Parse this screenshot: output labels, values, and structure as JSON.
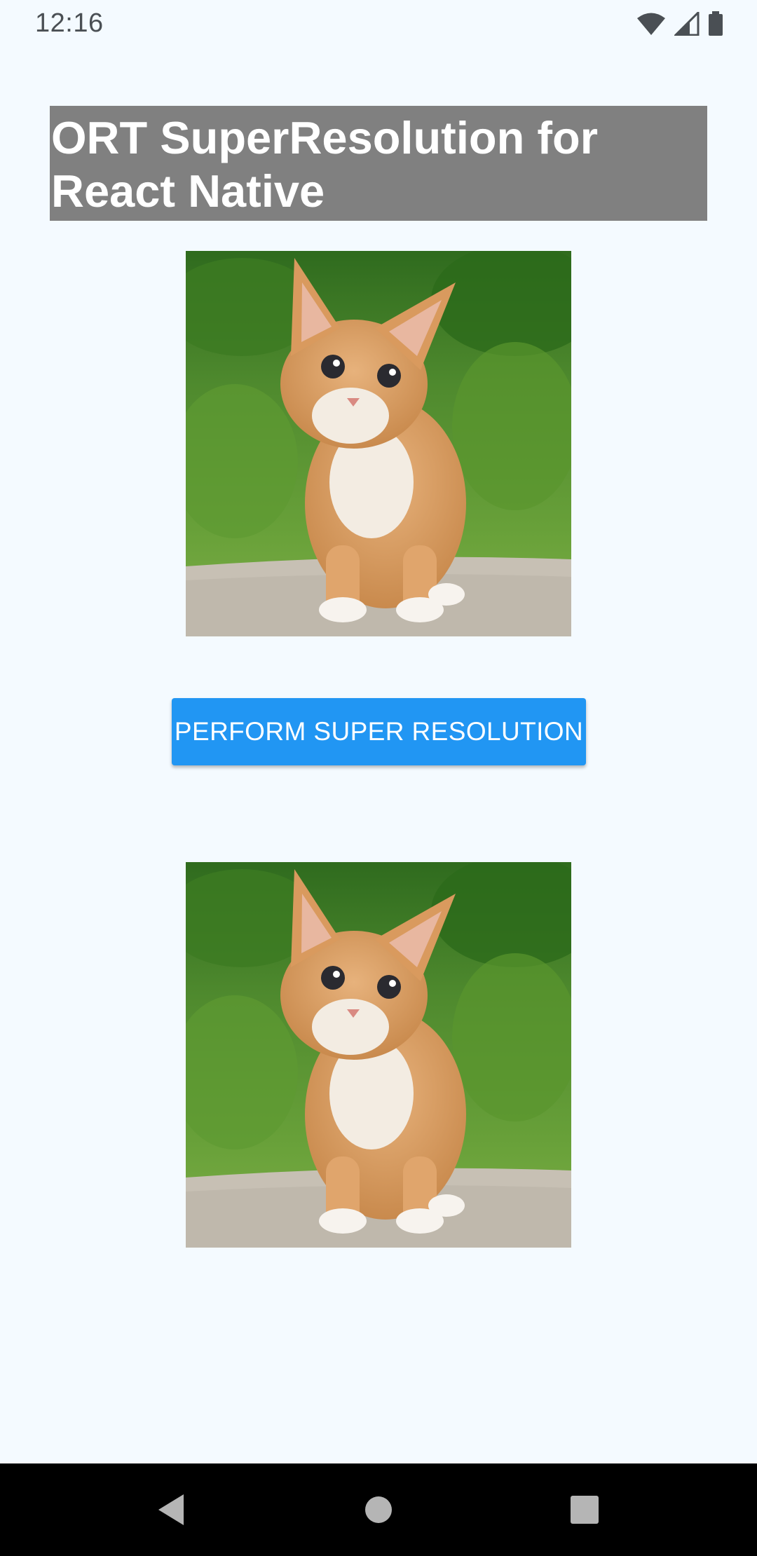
{
  "status_bar": {
    "time": "12:16",
    "icons": [
      "wifi-icon",
      "cellular-signal-icon",
      "battery-icon"
    ]
  },
  "app": {
    "title": "ORT SuperResolution for React Native",
    "input_image": {
      "alt": "orange-tabby-kitten-photo"
    },
    "output_image": {
      "alt": "orange-tabby-kitten-photo"
    },
    "perform_button_label": "PERFORM SUPER RESOLUTION"
  },
  "nav_bar": {
    "buttons": [
      "back-icon",
      "home-icon",
      "recents-icon"
    ]
  },
  "colors": {
    "background": "#f4faff",
    "title_banner": "#808080",
    "button": "#2196f3",
    "nav_bar": "#000000"
  }
}
